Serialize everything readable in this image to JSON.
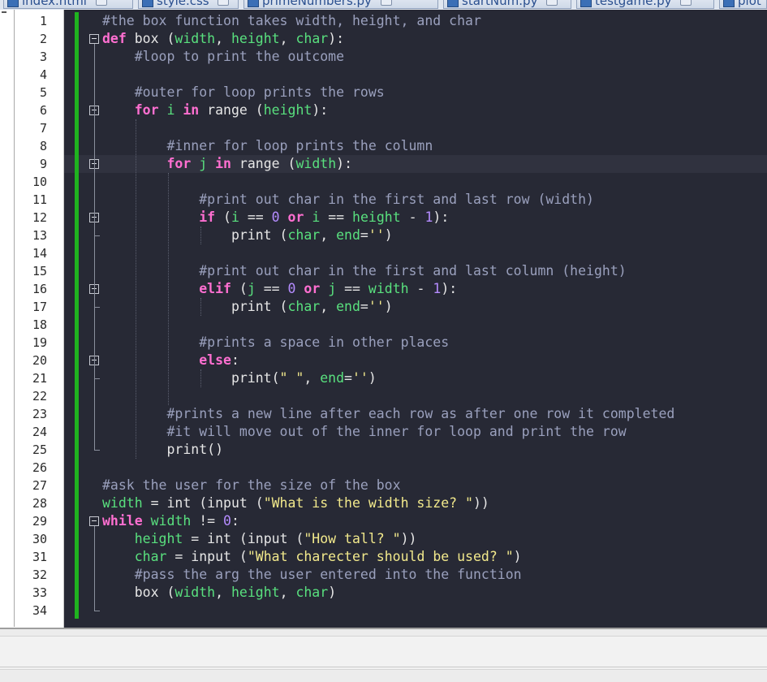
{
  "tabs": [
    {
      "label": "index.html"
    },
    {
      "label": "style.css"
    },
    {
      "label": "primeNumbers.py"
    },
    {
      "label": "startNum.py"
    },
    {
      "label": "testgame.py"
    },
    {
      "label": "plot"
    }
  ],
  "colors": {
    "editor_background": "#272935",
    "keyword": "#ff6fd1",
    "comment": "#9aa0bd",
    "number": "#b58cff",
    "identifier": "#59e07e",
    "string": "#f2e98c",
    "change_bar": "#1fb31f"
  },
  "icons": {
    "file_icon": "python-file-icon",
    "tab_close": "close-icon",
    "fold_marker": "fold-minus-icon"
  },
  "editor": {
    "current_line": 9,
    "lines": [
      {
        "n": "1",
        "tokens": [
          {
            "t": "#the box function takes width, height, and char",
            "c": "cm"
          }
        ]
      },
      {
        "n": "2",
        "tokens": [
          {
            "t": "def",
            "c": "kw"
          },
          {
            "t": " box ("
          },
          {
            "t": "width",
            "c": "id"
          },
          {
            "t": ", "
          },
          {
            "t": "height",
            "c": "id"
          },
          {
            "t": ", "
          },
          {
            "t": "char",
            "c": "id"
          },
          {
            "t": "):"
          }
        ]
      },
      {
        "n": "3",
        "tokens": [
          {
            "t": "    "
          },
          {
            "t": "#loop to print the outcome",
            "c": "cm"
          }
        ]
      },
      {
        "n": "4",
        "tokens": []
      },
      {
        "n": "5",
        "tokens": [
          {
            "t": "    "
          },
          {
            "t": "#outer for loop prints the rows",
            "c": "cm"
          }
        ]
      },
      {
        "n": "6",
        "tokens": [
          {
            "t": "    "
          },
          {
            "t": "for",
            "c": "kw"
          },
          {
            "t": " "
          },
          {
            "t": "i",
            "c": "id"
          },
          {
            "t": " "
          },
          {
            "t": "in",
            "c": "kw"
          },
          {
            "t": " range ("
          },
          {
            "t": "height",
            "c": "id"
          },
          {
            "t": "):"
          }
        ]
      },
      {
        "n": "7",
        "tokens": []
      },
      {
        "n": "8",
        "tokens": [
          {
            "t": "        "
          },
          {
            "t": "#inner for loop prints the column",
            "c": "cm"
          }
        ]
      },
      {
        "n": "9",
        "tokens": [
          {
            "t": "        "
          },
          {
            "t": "for",
            "c": "kw"
          },
          {
            "t": " "
          },
          {
            "t": "j",
            "c": "id"
          },
          {
            "t": " "
          },
          {
            "t": "in",
            "c": "kw"
          },
          {
            "t": " range ("
          },
          {
            "t": "width",
            "c": "id"
          },
          {
            "t": "):"
          }
        ]
      },
      {
        "n": "10",
        "tokens": []
      },
      {
        "n": "11",
        "tokens": [
          {
            "t": "            "
          },
          {
            "t": "#print out char in the first and last row (width)",
            "c": "cm"
          }
        ]
      },
      {
        "n": "12",
        "tokens": [
          {
            "t": "            "
          },
          {
            "t": "if",
            "c": "kw"
          },
          {
            "t": " ("
          },
          {
            "t": "i",
            "c": "id"
          },
          {
            "t": " == "
          },
          {
            "t": "0",
            "c": "nm"
          },
          {
            "t": " "
          },
          {
            "t": "or",
            "c": "kw"
          },
          {
            "t": " "
          },
          {
            "t": "i",
            "c": "id"
          },
          {
            "t": " == "
          },
          {
            "t": "height",
            "c": "id"
          },
          {
            "t": " - "
          },
          {
            "t": "1",
            "c": "nm"
          },
          {
            "t": "):"
          }
        ]
      },
      {
        "n": "13",
        "tokens": [
          {
            "t": "                print ("
          },
          {
            "t": "char",
            "c": "id"
          },
          {
            "t": ", "
          },
          {
            "t": "end",
            "c": "id"
          },
          {
            "t": "="
          },
          {
            "t": "''",
            "c": "st"
          },
          {
            "t": ")"
          }
        ]
      },
      {
        "n": "14",
        "tokens": []
      },
      {
        "n": "15",
        "tokens": [
          {
            "t": "            "
          },
          {
            "t": "#print out char in the first and last column (height)",
            "c": "cm"
          }
        ]
      },
      {
        "n": "16",
        "tokens": [
          {
            "t": "            "
          },
          {
            "t": "elif",
            "c": "kw"
          },
          {
            "t": " ("
          },
          {
            "t": "j",
            "c": "id"
          },
          {
            "t": " == "
          },
          {
            "t": "0",
            "c": "nm"
          },
          {
            "t": " "
          },
          {
            "t": "or",
            "c": "kw"
          },
          {
            "t": " "
          },
          {
            "t": "j",
            "c": "id"
          },
          {
            "t": " == "
          },
          {
            "t": "width",
            "c": "id"
          },
          {
            "t": " - "
          },
          {
            "t": "1",
            "c": "nm"
          },
          {
            "t": "):"
          }
        ]
      },
      {
        "n": "17",
        "tokens": [
          {
            "t": "                print ("
          },
          {
            "t": "char",
            "c": "id"
          },
          {
            "t": ", "
          },
          {
            "t": "end",
            "c": "id"
          },
          {
            "t": "="
          },
          {
            "t": "''",
            "c": "st"
          },
          {
            "t": ")"
          }
        ]
      },
      {
        "n": "18",
        "tokens": []
      },
      {
        "n": "19",
        "tokens": [
          {
            "t": "            "
          },
          {
            "t": "#prints a space in other places",
            "c": "cm"
          }
        ]
      },
      {
        "n": "20",
        "tokens": [
          {
            "t": "            "
          },
          {
            "t": "else",
            "c": "kw"
          },
          {
            "t": ":"
          }
        ]
      },
      {
        "n": "21",
        "tokens": [
          {
            "t": "                print("
          },
          {
            "t": "\" \"",
            "c": "st"
          },
          {
            "t": ", "
          },
          {
            "t": "end",
            "c": "id"
          },
          {
            "t": "="
          },
          {
            "t": "''",
            "c": "st"
          },
          {
            "t": ")"
          }
        ]
      },
      {
        "n": "22",
        "tokens": []
      },
      {
        "n": "23",
        "tokens": [
          {
            "t": "        "
          },
          {
            "t": "#prints a new line after each row as after one row it completed",
            "c": "cm"
          }
        ]
      },
      {
        "n": "24",
        "tokens": [
          {
            "t": "        "
          },
          {
            "t": "#it will move out of the inner for loop and print the row",
            "c": "cm"
          }
        ]
      },
      {
        "n": "25",
        "tokens": [
          {
            "t": "        print()"
          }
        ]
      },
      {
        "n": "26",
        "tokens": []
      },
      {
        "n": "27",
        "tokens": [
          {
            "t": "#ask the user for the size of the box",
            "c": "cm"
          }
        ]
      },
      {
        "n": "28",
        "tokens": [
          {
            "t": "width",
            "c": "id"
          },
          {
            "t": " = int (input ("
          },
          {
            "t": "\"What is the width size? \"",
            "c": "st"
          },
          {
            "t": "))"
          }
        ]
      },
      {
        "n": "29",
        "tokens": [
          {
            "t": "while",
            "c": "kw"
          },
          {
            "t": " "
          },
          {
            "t": "width",
            "c": "id"
          },
          {
            "t": " != "
          },
          {
            "t": "0",
            "c": "nm"
          },
          {
            "t": ":"
          }
        ]
      },
      {
        "n": "30",
        "tokens": [
          {
            "t": "    "
          },
          {
            "t": "height",
            "c": "id"
          },
          {
            "t": " = int (input ("
          },
          {
            "t": "\"How tall? \"",
            "c": "st"
          },
          {
            "t": "))"
          }
        ]
      },
      {
        "n": "31",
        "tokens": [
          {
            "t": "    "
          },
          {
            "t": "char",
            "c": "id"
          },
          {
            "t": " = input ("
          },
          {
            "t": "\"What charecter should be used? \"",
            "c": "st"
          },
          {
            "t": ")"
          }
        ]
      },
      {
        "n": "32",
        "tokens": [
          {
            "t": "    "
          },
          {
            "t": "#pass the arg the user entered into the function",
            "c": "cm"
          }
        ]
      },
      {
        "n": "33",
        "tokens": [
          {
            "t": "    box ("
          },
          {
            "t": "width",
            "c": "id"
          },
          {
            "t": ", "
          },
          {
            "t": "height",
            "c": "id"
          },
          {
            "t": ", "
          },
          {
            "t": "char",
            "c": "id"
          },
          {
            "t": ")"
          }
        ]
      },
      {
        "n": "34",
        "tokens": []
      }
    ]
  }
}
